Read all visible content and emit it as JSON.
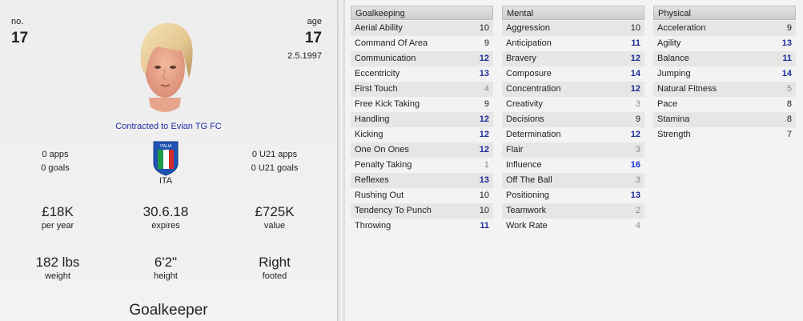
{
  "profile": {
    "number_label": "no.",
    "number": "17",
    "age_label": "age",
    "age": "17",
    "dob": "2.5.1997",
    "contract": "Contracted to Evian TG FC",
    "apps": "0 apps",
    "goals": "0 goals",
    "u21_apps": "0 U21 apps",
    "u21_goals": "0 U21 goals",
    "nation": "ITA",
    "flag_text": "ITALIA",
    "wage": "£18K",
    "wage_label": "per year",
    "expires": "30.6.18",
    "expires_label": "expires",
    "value": "£725K",
    "value_label": "value",
    "weight": "182 lbs",
    "weight_label": "weight",
    "height": "6'2\"",
    "height_label": "height",
    "foot": "Right",
    "foot_label": "footed",
    "position": "Goalkeeper"
  },
  "goalkeeping": {
    "title": "Goalkeeping",
    "rows": [
      {
        "name": "Aerial Ability",
        "value": "10"
      },
      {
        "name": "Command Of Area",
        "value": "9"
      },
      {
        "name": "Communication",
        "value": "12"
      },
      {
        "name": "Eccentricity",
        "value": "13"
      },
      {
        "name": "First Touch",
        "value": "4"
      },
      {
        "name": "Free Kick Taking",
        "value": "9"
      },
      {
        "name": "Handling",
        "value": "12"
      },
      {
        "name": "Kicking",
        "value": "12"
      },
      {
        "name": "One On Ones",
        "value": "12"
      },
      {
        "name": "Penalty Taking",
        "value": "1"
      },
      {
        "name": "Reflexes",
        "value": "13"
      },
      {
        "name": "Rushing Out",
        "value": "10"
      },
      {
        "name": "Tendency To Punch",
        "value": "10"
      },
      {
        "name": "Throwing",
        "value": "11"
      }
    ]
  },
  "mental": {
    "title": "Mental",
    "rows": [
      {
        "name": "Aggression",
        "value": "10"
      },
      {
        "name": "Anticipation",
        "value": "11"
      },
      {
        "name": "Bravery",
        "value": "12"
      },
      {
        "name": "Composure",
        "value": "14"
      },
      {
        "name": "Concentration",
        "value": "12"
      },
      {
        "name": "Creativity",
        "value": "3"
      },
      {
        "name": "Decisions",
        "value": "9"
      },
      {
        "name": "Determination",
        "value": "12"
      },
      {
        "name": "Flair",
        "value": "3"
      },
      {
        "name": "Influence",
        "value": "16"
      },
      {
        "name": "Off The Ball",
        "value": "3"
      },
      {
        "name": "Positioning",
        "value": "13"
      },
      {
        "name": "Teamwork",
        "value": "2"
      },
      {
        "name": "Work Rate",
        "value": "4"
      }
    ]
  },
  "physical": {
    "title": "Physical",
    "rows": [
      {
        "name": "Acceleration",
        "value": "9"
      },
      {
        "name": "Agility",
        "value": "13"
      },
      {
        "name": "Balance",
        "value": "11"
      },
      {
        "name": "Jumping",
        "value": "14"
      },
      {
        "name": "Natural Fitness",
        "value": "5"
      },
      {
        "name": "Pace",
        "value": "8"
      },
      {
        "name": "Stamina",
        "value": "8"
      },
      {
        "name": "Strength",
        "value": "7"
      }
    ]
  },
  "colors": {
    "high_value": "#1c2b98",
    "top_value": "#1432d6",
    "low_value": "#8c8c8c",
    "contract_link": "#1f2fa8"
  }
}
